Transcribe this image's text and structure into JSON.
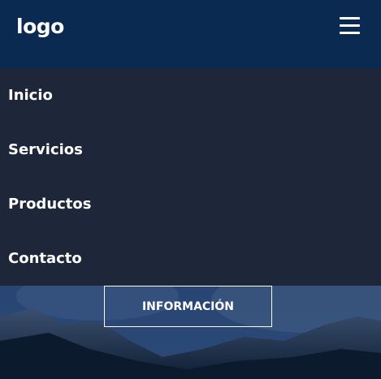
{
  "header": {
    "logo_text": "logo",
    "menu_icon": "hamburger-menu-icon"
  },
  "menu": {
    "items": [
      {
        "label": "Inicio"
      },
      {
        "label": "Servicios"
      },
      {
        "label": "Productos"
      },
      {
        "label": "Contacto"
      }
    ]
  },
  "hero": {
    "button_label": "INFORMACIÓN"
  },
  "colors": {
    "header_bg": "#0a2a52",
    "menu_bg": "#1e2739",
    "text": "#ffffff"
  }
}
